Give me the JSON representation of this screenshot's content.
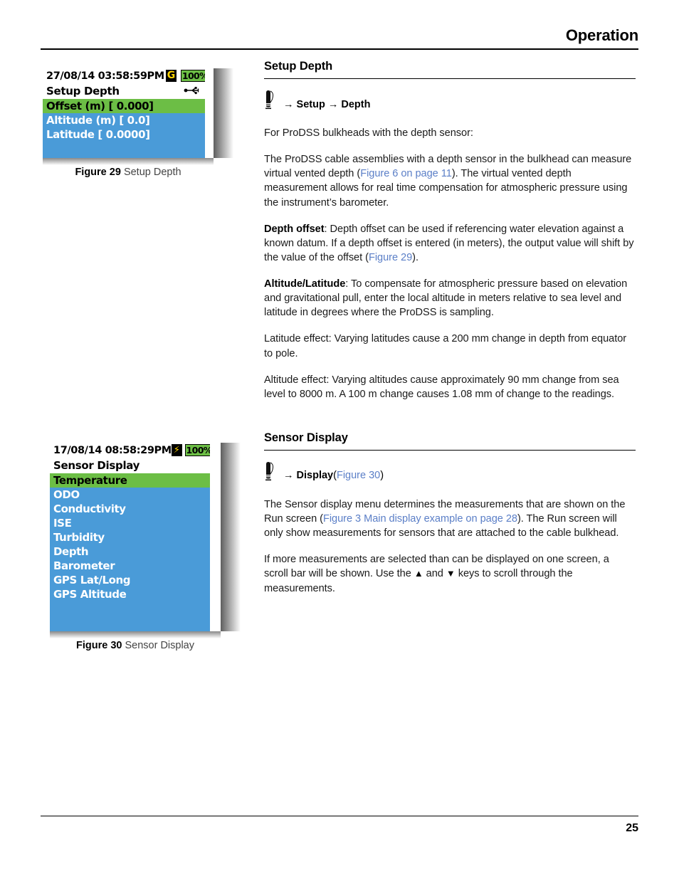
{
  "header": {
    "title": "Operation"
  },
  "footer": {
    "page_number": "25"
  },
  "figures": [
    {
      "id": "figure-29",
      "caption_label": "Figure 29",
      "caption_text": "Setup Depth",
      "screen": {
        "datetime": "27/08/14  03:58:59PM",
        "gps_badge": "G",
        "battery": "100%",
        "title": "Setup Depth",
        "usb_icon": "usb-icon",
        "rows": [
          {
            "label": "Offset (m) [ 0.000]",
            "selected": true
          },
          {
            "label": "Altitude (m) [ 0.0]",
            "selected": false
          },
          {
            "label": "Latitude [  0.0000]",
            "selected": false
          }
        ]
      }
    },
    {
      "id": "figure-30",
      "caption_label": "Figure 30",
      "caption_text": "Sensor Display",
      "screen": {
        "datetime": "17/08/14  08:58:29PM",
        "charge_badge": "charging-bolt-icon",
        "battery": "100%",
        "title": "Sensor Display",
        "rows": [
          {
            "label": "Temperature",
            "selected": true
          },
          {
            "label": "ODO",
            "selected": false
          },
          {
            "label": "Conductivity",
            "selected": false
          },
          {
            "label": "ISE",
            "selected": false
          },
          {
            "label": "Turbidity",
            "selected": false
          },
          {
            "label": "Depth",
            "selected": false
          },
          {
            "label": "Barometer",
            "selected": false
          },
          {
            "label": "GPS Lat/Long",
            "selected": false
          },
          {
            "label": "GPS Altitude",
            "selected": false
          }
        ]
      }
    }
  ],
  "sections": [
    {
      "heading": "Setup Depth",
      "nav_path": {
        "icon": "probe-icon",
        "arrow1": "→",
        "item1": "Setup",
        "arrow2": "→",
        "item2": "Depth"
      },
      "paragraphs": {
        "p1": "For ProDSS bulkheads with the depth sensor:",
        "p2_a": "The ProDSS cable assemblies with a depth sensor in the bulkhead can measure virtual vented depth (",
        "p2_link": "Figure 6 on page 11",
        "p2_b": "). The virtual vented depth measurement allows for real time compensation for atmospheric pressure using the instrument’s barometer.",
        "p3_bold": "Depth offset",
        "p3_a": ": Depth offset can be used if referencing water elevation against a known datum. If a depth offset is entered (in meters), the output value will shift by the value of the offset (",
        "p3_link": "Figure 29",
        "p3_b": ").",
        "p4_bold": "Altitude/Latitude",
        "p4_a": ": To compensate for atmospheric pressure based on elevation and gravitational pull, enter the local altitude in meters relative to sea level and latitude in degrees where the ProDSS is sampling.",
        "p5": "Latitude effect:  Varying latitudes cause a 200 mm change in depth from equator to pole.",
        "p6": "Altitude effect: Varying altitudes cause approximately 90 mm change from sea level to 8000 m. A 100 m change causes 1.08 mm of change to the readings."
      }
    },
    {
      "heading": "Sensor Display",
      "nav_path": {
        "icon": "probe-icon",
        "arrow1": "→",
        "item1": "Display",
        "paren_open": "(",
        "link": "Figure 30",
        "paren_close": ")"
      },
      "paragraphs": {
        "p1_a": "The Sensor display menu determines the measurements that are shown on the Run screen (",
        "p1_link": "Figure 3 Main display example on page 28",
        "p1_b": "). The Run screen will only show measurements for sensors that are attached to the cable bulkhead.",
        "p2_a": "If more measurements are selected than can be displayed on one screen, a scroll bar will be shown. Use the ",
        "p2_up": "▲",
        "p2_mid": " and ",
        "p2_down": "▼",
        "p2_b": " keys to scroll through the measurements."
      }
    }
  ],
  "colors": {
    "lcd_blue": "#4a9bd8",
    "lcd_green": "#6cbe45",
    "xref_blue": "#5b7fc7",
    "badge_yellow": "#ffd400"
  }
}
